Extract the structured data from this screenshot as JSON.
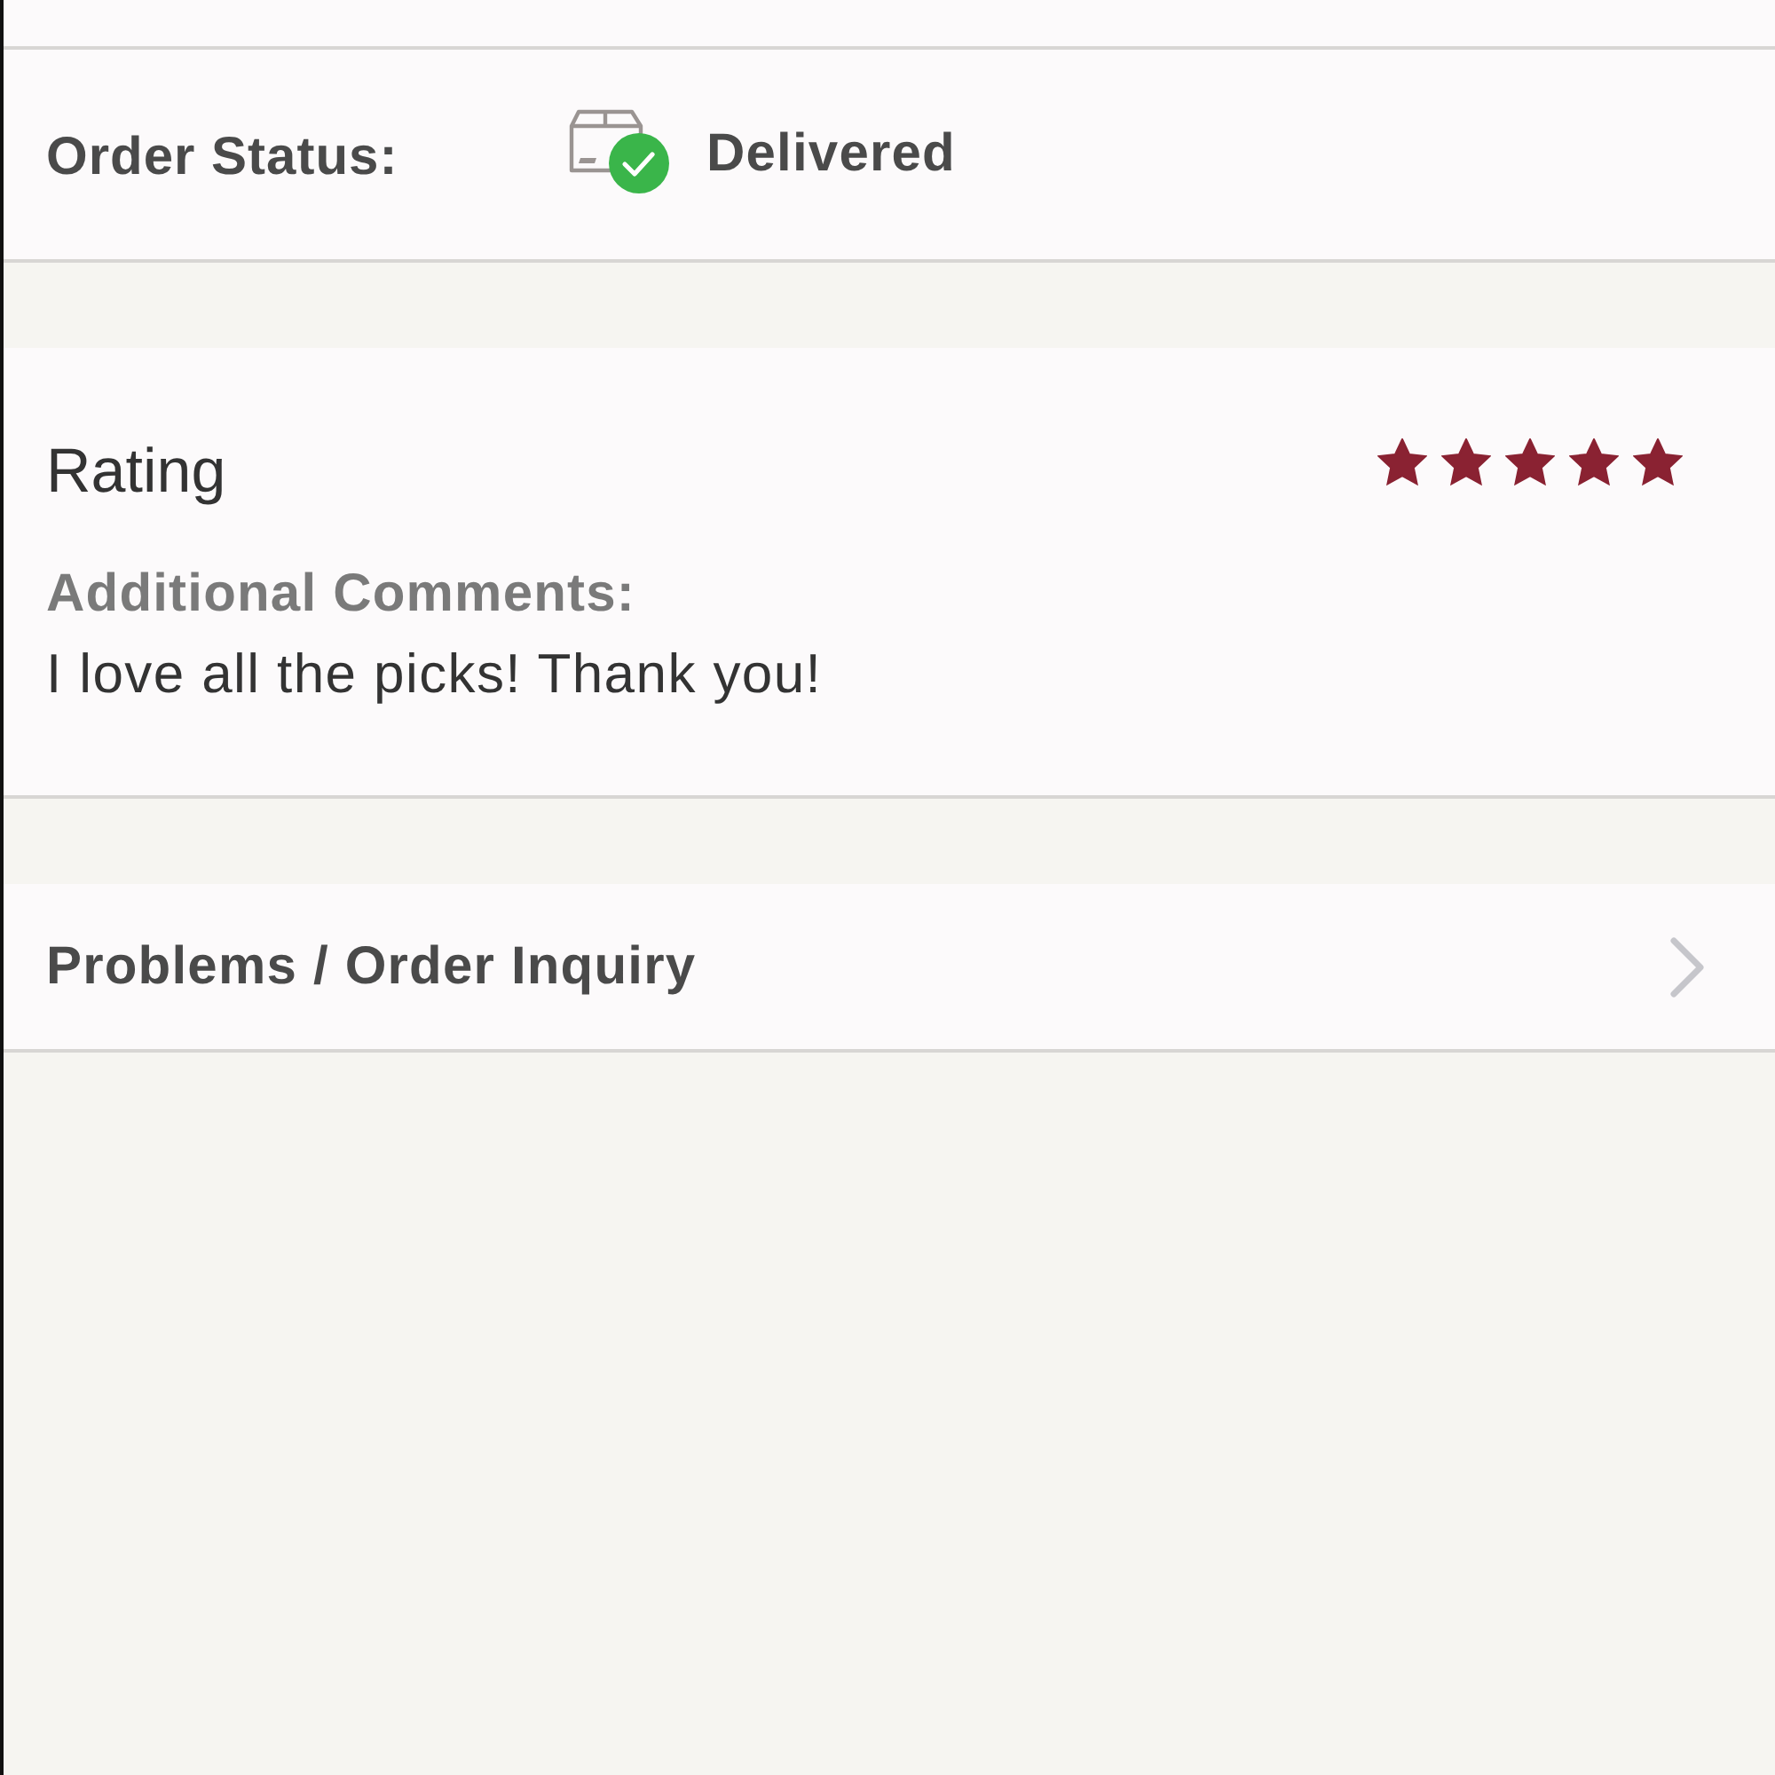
{
  "order_status": {
    "label": "Order Status:",
    "status": "Delivered"
  },
  "rating": {
    "title": "Rating",
    "stars": 5,
    "comments_label": "Additional Comments:",
    "comment": "I love all the picks! Thank you!"
  },
  "inquiry": {
    "label": "Problems / Order Inquiry"
  }
}
